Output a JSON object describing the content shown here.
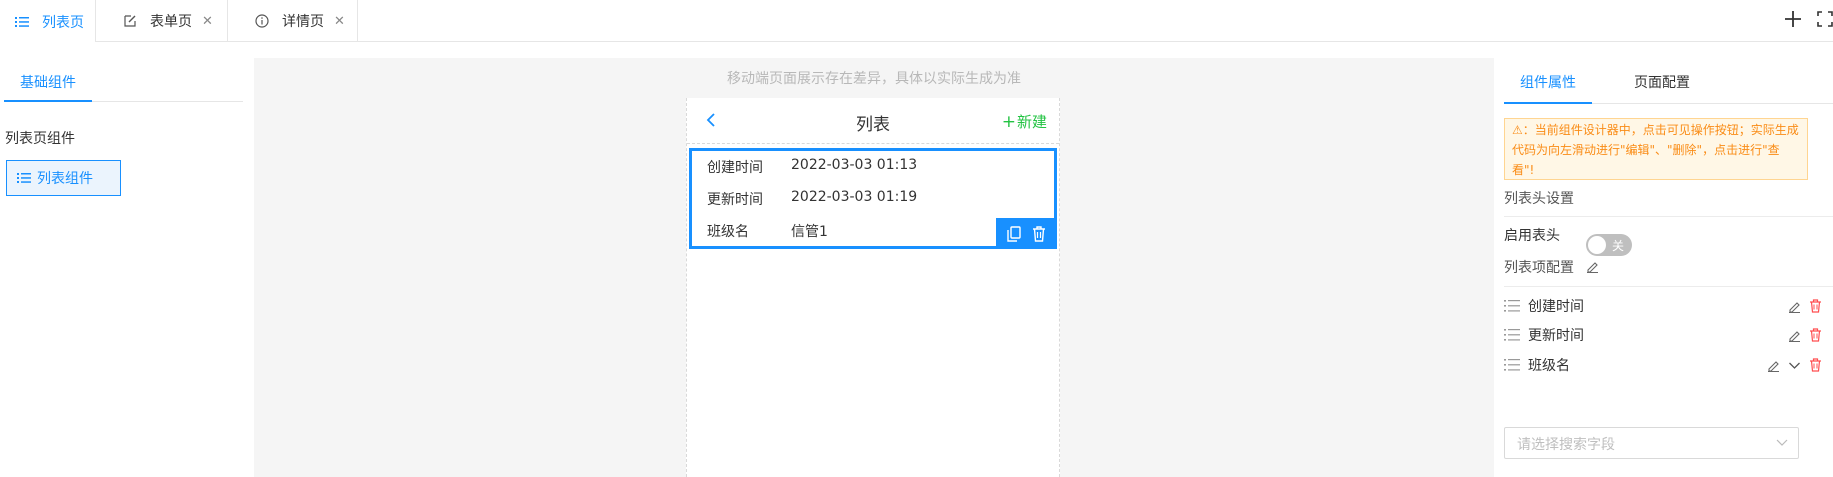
{
  "tabs": [
    {
      "label": "列表页",
      "icon": "list-icon",
      "closable": false,
      "active": true
    },
    {
      "label": "表单页",
      "icon": "edit-icon",
      "closable": true,
      "active": false
    },
    {
      "label": "详情页",
      "icon": "info-icon",
      "closable": true,
      "active": false
    }
  ],
  "left": {
    "tab": "基础组件",
    "heading": "列表页组件",
    "component": "列表组件"
  },
  "canvas": {
    "note": "移动端页面展示存在差异，具体以实际生成为准",
    "title": "列表",
    "new_label": "新建",
    "rows": [
      {
        "label": "创建时间",
        "value": "2022-03-03 01:13"
      },
      {
        "label": "更新时间",
        "value": "2022-03-03 01:19"
      },
      {
        "label": "班级名",
        "value": "信管1"
      }
    ]
  },
  "right": {
    "tabs": [
      "组件属性",
      "页面配置"
    ],
    "warning": "⚠：当前组件设计器中，点击可见操作按钮；实际生成代码为向左滑动进行\"编辑\"、\"删除\"，点击进行\"查看\"!",
    "header_section": "列表头设置",
    "enable_header_label": "启用表头",
    "switch_text": "关",
    "items_section": "列表项配置",
    "items": [
      "创建时间",
      "更新时间",
      "班级名"
    ],
    "select_placeholder": "请选择搜索字段"
  },
  "colors": {
    "accent": "#1890ff",
    "new": "#23c343",
    "danger": "#ff4d4f",
    "warning": "#fa8c16"
  }
}
